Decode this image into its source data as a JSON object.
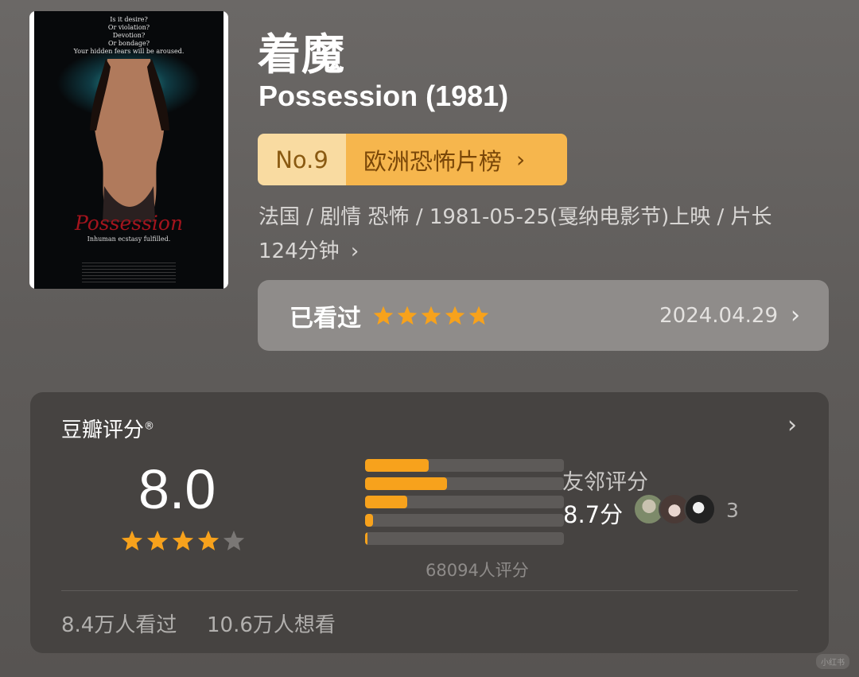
{
  "poster": {
    "tagline": "Is it desire?\nOr violation?\nDevotion?\nOr bondage?\nYour hidden fears will be aroused.",
    "title": "Possession",
    "subtitle": "Inhuman ecstasy fulfilled."
  },
  "movie": {
    "title_cn": "着魔",
    "title_en": "Possession (1981)"
  },
  "rank": {
    "number": "No.9",
    "list_name": "欧洲恐怖片榜",
    "chevron": "›"
  },
  "meta": {
    "line": "法国 / 剧情 恐怖 / 1981-05-25(戛纳电影节)上映 / 片长 124分钟",
    "chevron": "›"
  },
  "watched": {
    "label": "已看过",
    "stars": 5,
    "date": "2024.04.29",
    "chevron": "›"
  },
  "rating": {
    "title": "豆瓣评分",
    "mark": "®",
    "chevron": "›",
    "score": "8.0",
    "stars": 4,
    "distribution": [
      {
        "stars": 5,
        "fraction": 0.32
      },
      {
        "stars": 4,
        "fraction": 0.41
      },
      {
        "stars": 3,
        "fraction": 0.21
      },
      {
        "stars": 2,
        "fraction": 0.04
      },
      {
        "stars": 1,
        "fraction": 0.01
      }
    ],
    "rater_count": "68094人评分",
    "friends_label": "友邻评分",
    "friends_score": "8.7分",
    "friends_count": "3",
    "watched_count": "8.4万人看过",
    "want_count": "10.6万人想看"
  },
  "colors": {
    "accent": "#f7a21c",
    "rank_number_bg": "#f9dba1",
    "rank_name_bg": "#f6b64d",
    "empty_star": "#7a7775"
  },
  "watermark": "小红书"
}
